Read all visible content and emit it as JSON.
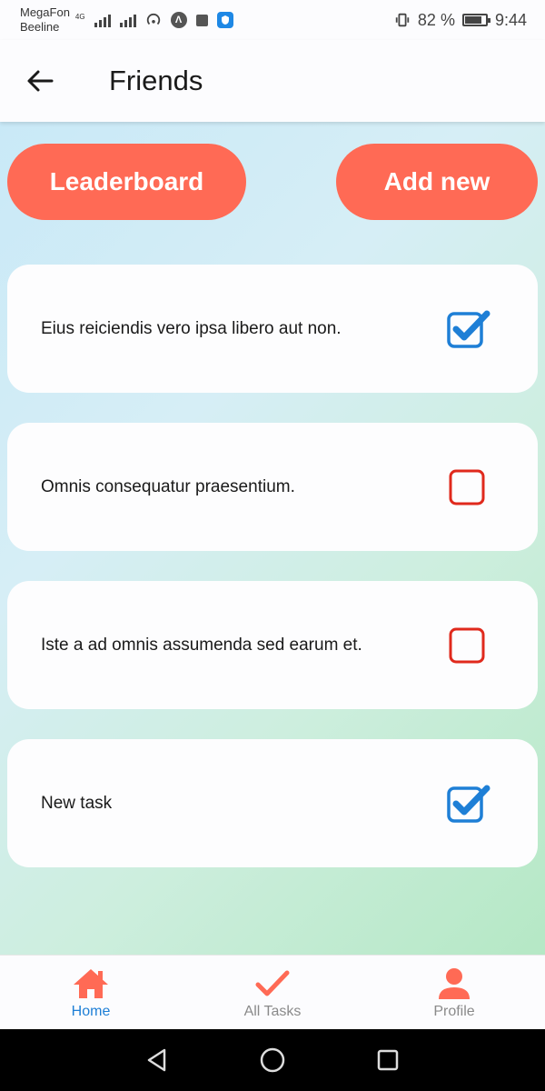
{
  "status_bar": {
    "carrier_1": "MegaFon",
    "carrier_2": "Beeline",
    "network": "4G",
    "battery": "82 %",
    "time": "9:44"
  },
  "app_bar": {
    "title": "Friends",
    "back_icon": "arrow-left-icon"
  },
  "actions": {
    "leaderboard_label": "Leaderboard",
    "add_new_label": "Add new",
    "button_color": "#ff6a55"
  },
  "tasks": [
    {
      "text": "Eius reiciendis vero ipsa libero aut non.",
      "checked": true
    },
    {
      "text": "Omnis consequatur praesentium.",
      "checked": false
    },
    {
      "text": "Iste a ad omnis assumenda sed earum et.",
      "checked": false
    },
    {
      "text": "New task",
      "checked": true
    }
  ],
  "colors": {
    "checked": "#1e7fd6",
    "unchecked": "#e0291c",
    "accent": "#ff6a55"
  },
  "bottom_nav": {
    "items": [
      {
        "label": "Home",
        "icon": "home-icon",
        "active": true
      },
      {
        "label": "All Tasks",
        "icon": "check-icon",
        "active": false
      },
      {
        "label": "Profile",
        "icon": "person-icon",
        "active": false
      }
    ]
  },
  "system_nav": {
    "icons": [
      "back-triangle-icon",
      "home-circle-icon",
      "recents-square-icon"
    ]
  }
}
